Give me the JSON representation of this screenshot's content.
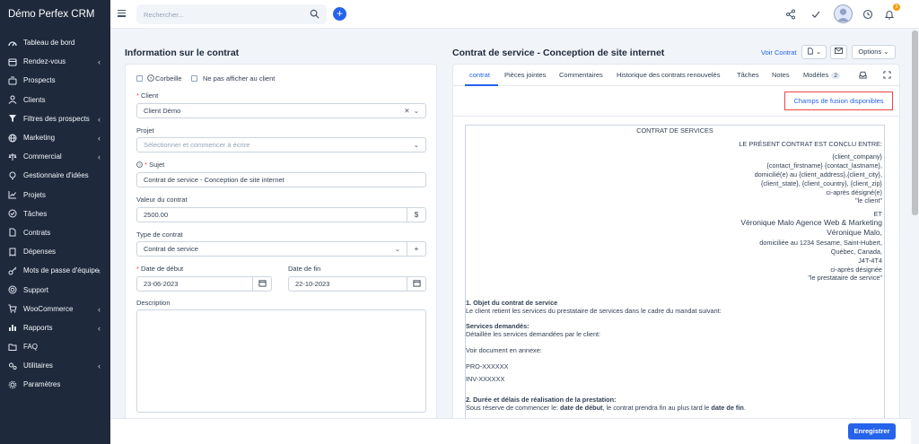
{
  "app": {
    "brand": "Démo Perfex CRM"
  },
  "sidebar": {
    "items": [
      {
        "label": "Tableau de bord",
        "icon": "gauge-icon",
        "chevron": false
      },
      {
        "label": "Rendez-vous",
        "icon": "calendar-icon",
        "chevron": true
      },
      {
        "label": "Prospects",
        "icon": "tty-icon",
        "chevron": false
      },
      {
        "label": "Clients",
        "icon": "user-icon",
        "chevron": false
      },
      {
        "label": "Filtres des prospects",
        "icon": "filter-icon",
        "chevron": true
      },
      {
        "label": "Marketing",
        "icon": "globe-icon",
        "chevron": true
      },
      {
        "label": "Commercial",
        "icon": "balance-icon",
        "chevron": true
      },
      {
        "label": "Gestionnaire d'idées",
        "icon": "lightbulb-icon",
        "chevron": false
      },
      {
        "label": "Projets",
        "icon": "chart-icon",
        "chevron": false
      },
      {
        "label": "Tâches",
        "icon": "check-circle-icon",
        "chevron": false
      },
      {
        "label": "Contrats",
        "icon": "file-icon",
        "chevron": false
      },
      {
        "label": "Dépenses",
        "icon": "receipt-icon",
        "chevron": false
      },
      {
        "label": "Mots de passe d'équipe",
        "icon": "key-icon",
        "chevron": true
      },
      {
        "label": "Support",
        "icon": "lifebuoy-icon",
        "chevron": false
      },
      {
        "label": "WooCommerce",
        "icon": "cart-icon",
        "chevron": true
      },
      {
        "label": "Rapports",
        "icon": "bar-chart-icon",
        "chevron": true
      },
      {
        "label": "FAQ",
        "icon": "folder-icon",
        "chevron": false
      },
      {
        "label": "Utilitaires",
        "icon": "cogs-icon",
        "chevron": true
      },
      {
        "label": "Paramètres",
        "icon": "gear-icon",
        "chevron": false
      }
    ]
  },
  "topbar": {
    "search_placeholder": "Rechercher...",
    "notification_count": "3"
  },
  "left_panel": {
    "title": "Information sur le contrat",
    "trash_label": "Corbeille",
    "hide_label": "Ne pas afficher au client",
    "client_label": "Client",
    "client_value": "Client Démo",
    "project_label": "Projet",
    "project_placeholder": "Sélectionner et commencer à écrire",
    "subject_label": "Sujet",
    "subject_value": "Contrat de service - Conception de site internet",
    "value_label": "Valeur du contrat",
    "value_value": "2500.00",
    "currency": "$",
    "type_label": "Type de contrat",
    "type_value": "Contrat de service",
    "start_label": "Date de début",
    "start_value": "23-06-2023",
    "end_label": "Date de fin",
    "end_value": "22-10-2023",
    "description_label": "Description"
  },
  "right_panel": {
    "title": "Contrat de service - Conception de site internet",
    "view_link": "Voir Contrat",
    "options_label": "Options",
    "tabs": [
      {
        "label": "contrat"
      },
      {
        "label": "Pièces jointes"
      },
      {
        "label": "Commentaires"
      },
      {
        "label": "Historique des contrats renouvelés"
      },
      {
        "label": "Tâches"
      },
      {
        "label": "Notes"
      },
      {
        "label": "Modèles",
        "count": "2"
      }
    ],
    "merge_fields_button": "Champs de fusion disponibles",
    "document": {
      "heading": "CONTRAT DE SERVICES",
      "intro": "LE PRÉSENT CONTRAT EST CONCLU ENTRE:",
      "party1": [
        "{client_company}",
        "{contact_firstname} {contact_lastname},",
        "domicilié(e) au {client_address},{client_city},",
        "{client_state}, {client_country}, {client_zip}",
        "ci-après désigné(e)",
        "\"le client\""
      ],
      "and": "ET",
      "party2_company": "Véronique Malo Agence Web & Marketing",
      "party2_name": "Véronique Malo,",
      "party2": [
        "domiciliée au 1234 Sesame, Saint-Hubert,",
        "Québec, Canada,",
        "J4T-4T4",
        "ci-après désignée",
        "\"le prestataire de service\""
      ],
      "s1_title": "1. Objet du contrat de service",
      "s1_text": "Le client retient les services du prestataire de services dans le cadre du mandat suivant:",
      "services_title": "Services demandés:",
      "services_text": "Détaillée les services demandées par le client:",
      "annex_text": "Voir document en annexe:",
      "ref1": "PRO-XXXXXX",
      "ref2": "INV-XXXXXX",
      "s2_title": "2. Durée et délais de réalisation de la prestation:",
      "s2_a": "Sous réserve de commencer le: ",
      "s2_b": "date de début",
      "s2_c": ", le contrat prendra fin au plus tard le ",
      "s2_d": "date de fin",
      "s2_e": "."
    }
  },
  "footer": {
    "save_label": "Enregistrer"
  },
  "colors": {
    "sidebar": "#1e293b",
    "accent": "#2563eb",
    "danger": "#ef4444"
  }
}
